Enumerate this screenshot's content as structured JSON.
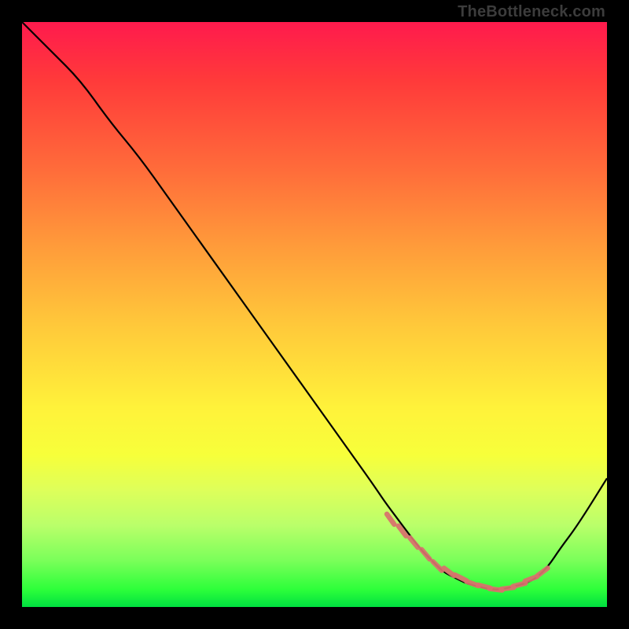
{
  "watermark": "TheBottleneck.com",
  "chart_data": {
    "type": "line",
    "title": "",
    "xlabel": "",
    "ylabel": "",
    "xlim": [
      0,
      100
    ],
    "ylim": [
      0,
      100
    ],
    "grid": false,
    "legend": false,
    "series": [
      {
        "name": "bottleneck-curve",
        "x": [
          0,
          5,
          10,
          15,
          20,
          25,
          30,
          35,
          40,
          45,
          50,
          55,
          60,
          62,
          65,
          68,
          70,
          72,
          74,
          76,
          78,
          80,
          82,
          84,
          86,
          88,
          90,
          92,
          95,
          100
        ],
        "y": [
          100,
          95,
          90,
          83,
          77,
          70,
          63,
          56,
          49,
          42,
          35,
          28,
          21,
          18,
          14,
          10,
          8,
          6,
          5,
          4,
          3.5,
          3,
          3,
          3.5,
          4,
          5,
          7,
          10,
          14,
          22
        ]
      },
      {
        "name": "highlight-ticks",
        "x": [
          63,
          65,
          67,
          69,
          71,
          73,
          75,
          77,
          79,
          81,
          83,
          85,
          87,
          89
        ],
        "y": [
          15,
          13,
          11,
          9,
          7,
          6,
          5,
          4,
          3.5,
          3,
          3.2,
          3.8,
          4.8,
          6
        ]
      }
    ]
  }
}
